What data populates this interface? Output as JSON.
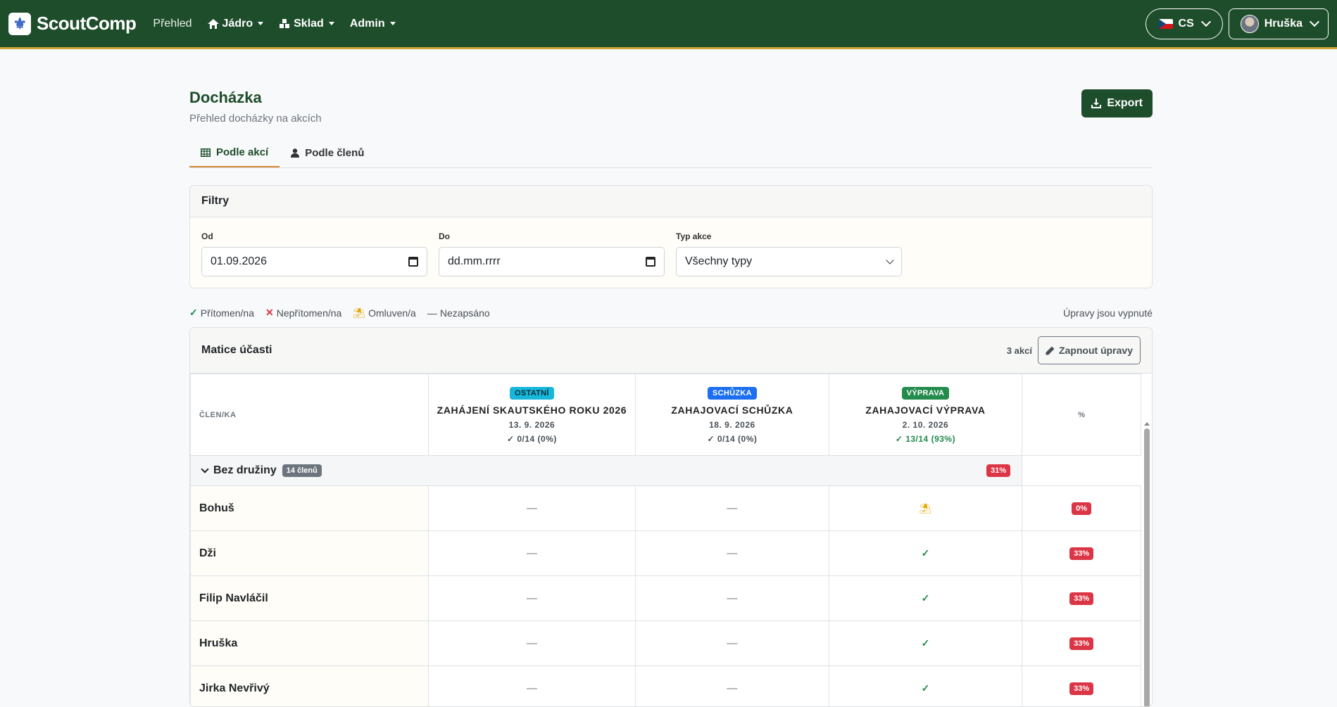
{
  "navbar": {
    "brand": "ScoutComp",
    "items": [
      {
        "label": "Přehled"
      },
      {
        "label": "Jádro"
      },
      {
        "label": "Sklad"
      },
      {
        "label": "Admin"
      }
    ],
    "lang": "CS",
    "user": "Hruška"
  },
  "page": {
    "title": "Docházka",
    "subtitle": "Přehled docházky na akcích",
    "export_label": "Export"
  },
  "tabs": [
    {
      "label": "Podle akcí",
      "active": true
    },
    {
      "label": "Podle členů",
      "active": false
    }
  ],
  "filters": {
    "title": "Filtry",
    "from": {
      "label": "Od",
      "value": "01.09.2026"
    },
    "to": {
      "label": "Do",
      "value": "dd.mm.rrrr"
    },
    "type": {
      "label": "Typ akce",
      "value": "Všechny typy"
    }
  },
  "legend": {
    "present": "Přítomen/na",
    "absent": "Nepřítomen/na",
    "excused": "Omluven/a",
    "unrecorded": "Nezapsáno",
    "edit_status": "Úpravy jsou vypnuté"
  },
  "matrix": {
    "title": "Matice účasti",
    "count": "3 akcí",
    "edit_button": "Zapnout úpravy",
    "col_member": "ČLEN/KA",
    "col_pct": "%",
    "events": [
      {
        "badge": "OSTATNÍ",
        "name": "ZAHÁJENÍ SKAUTSKÉHO ROKU 2026",
        "date": "13. 9. 2026",
        "stat": "0/14 (0%)"
      },
      {
        "badge": "SCHŮZKA",
        "name": "ZAHAJOVACÍ SCHŮZKA",
        "date": "18. 9. 2026",
        "stat": "0/14 (0%)"
      },
      {
        "badge": "VÝPRAVA",
        "name": "ZAHAJOVACÍ VÝPRAVA",
        "date": "2. 10. 2026",
        "stat": "13/14 (93%)"
      }
    ],
    "group": {
      "name": "Bez družiny",
      "count": "14 členů",
      "pct": "31%"
    },
    "members": [
      {
        "name": "Bohuš",
        "pct": "0%"
      },
      {
        "name": "Dži",
        "pct": "33%"
      },
      {
        "name": "Filip Navláčil",
        "pct": "33%"
      },
      {
        "name": "Hruška",
        "pct": "33%"
      },
      {
        "name": "Jirka Nevřivý",
        "pct": "33%"
      }
    ]
  },
  "colors": {
    "navbar": "#1e4d2b",
    "accent": "#d4a437",
    "present": "#1f8a4c",
    "absent": "#dc3545",
    "excused": "#e0a800"
  }
}
